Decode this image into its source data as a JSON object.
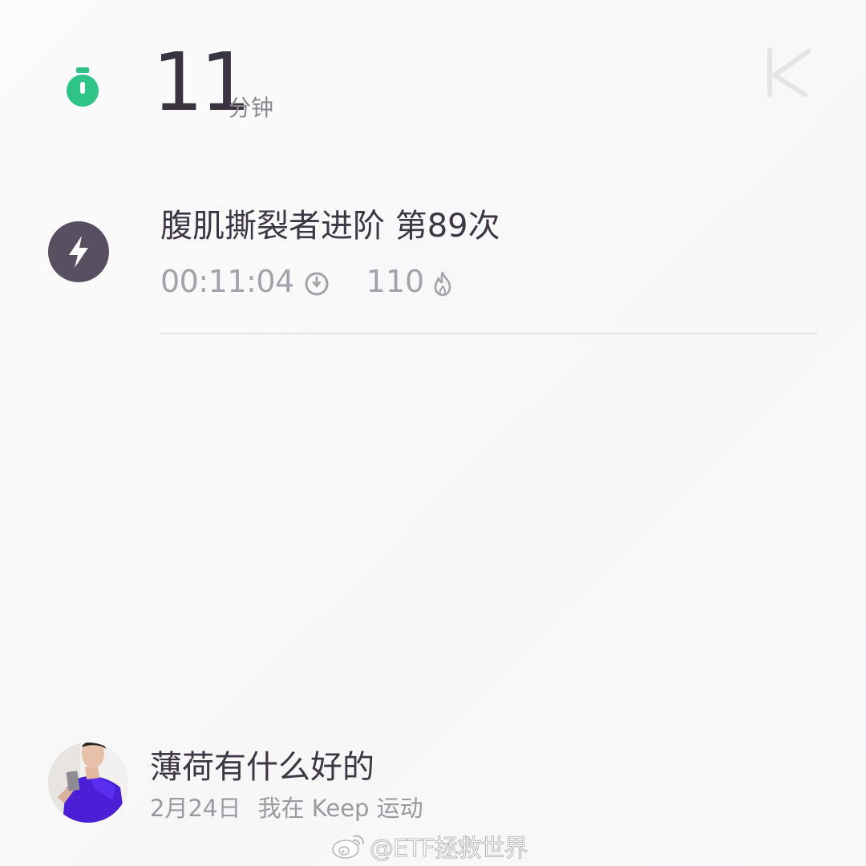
{
  "summary": {
    "duration_value": "11",
    "duration_unit": "分钟",
    "timer_icon": "stopwatch-icon",
    "brand_logo": "keep-k-logo"
  },
  "workout": {
    "icon": "lightning-icon",
    "title": "腹肌撕裂者进阶 第89次",
    "time": "00:11:04",
    "time_icon": "clock-icon",
    "calories": "110",
    "calories_icon": "flame-icon"
  },
  "user": {
    "avatar": "user-avatar",
    "name": "薄荷有什么好的",
    "date": "2月24日",
    "activity_text": "我在 Keep 运动"
  },
  "watermark": {
    "icon": "weibo-icon",
    "text": "@ETF拯救世界"
  },
  "colors": {
    "accent_green": "#2ec387",
    "dark_purple": "#584f60",
    "background": "#f9f9fa"
  }
}
